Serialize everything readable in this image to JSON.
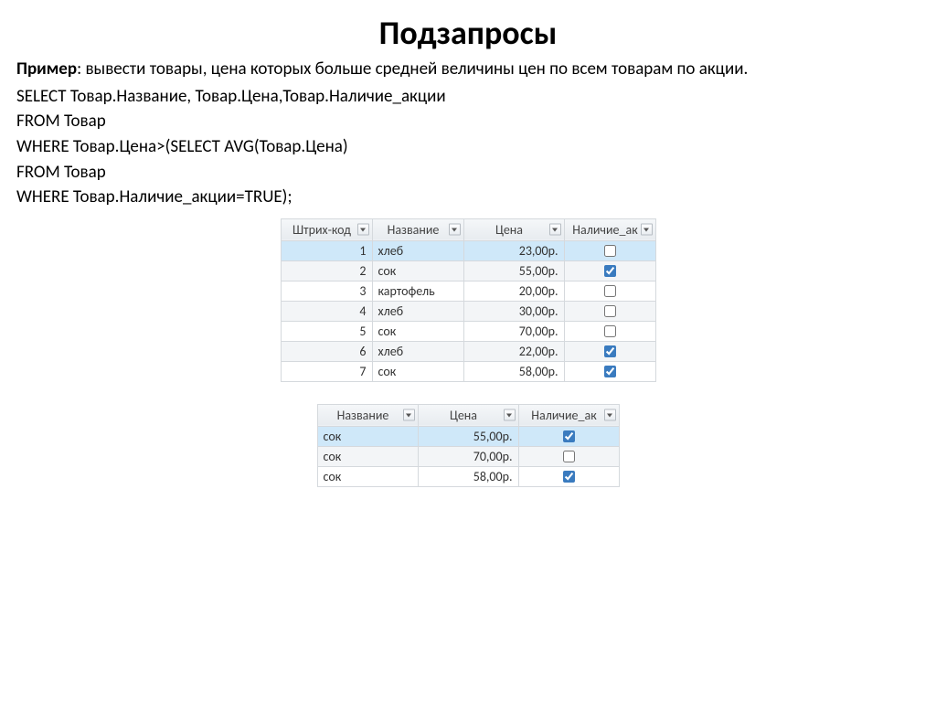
{
  "title": "Подзапросы",
  "desc_bold": "Пример",
  "desc_rest": ": вывести товары, цена которых больше средней величины цен по всем товарам по акции.",
  "sql": [
    "SELECT Товар.Название, Товар.Цена,Товар.Наличие_акции",
    "FROM Товар",
    "WHERE Товар.Цена>(SELECT AVG(Товар.Цена)",
    "FROM Товар",
    "WHERE Товар.Наличие_акции=TRUE);"
  ],
  "table1": {
    "headers": [
      "Штрих-код",
      "Название",
      "Цена",
      "Наличие_ак"
    ],
    "rows": [
      {
        "code": "1",
        "name": "хлеб",
        "price": "23,00р.",
        "sale": false,
        "sel": true
      },
      {
        "code": "2",
        "name": "сок",
        "price": "55,00р.",
        "sale": true,
        "alt": true
      },
      {
        "code": "3",
        "name": "картофель",
        "price": "20,00р.",
        "sale": false
      },
      {
        "code": "4",
        "name": "хлеб",
        "price": "30,00р.",
        "sale": false,
        "alt": true
      },
      {
        "code": "5",
        "name": "сок",
        "price": "70,00р.",
        "sale": false
      },
      {
        "code": "6",
        "name": "хлеб",
        "price": "22,00р.",
        "sale": true,
        "alt": true
      },
      {
        "code": "7",
        "name": "сок",
        "price": "58,00р.",
        "sale": true
      }
    ]
  },
  "table2": {
    "headers": [
      "Название",
      "Цена",
      "Наличие_ак"
    ],
    "rows": [
      {
        "name": "сок",
        "price": "55,00р.",
        "sale": true,
        "sel": true
      },
      {
        "name": "сок",
        "price": "70,00р.",
        "sale": false,
        "alt": true
      },
      {
        "name": "сок",
        "price": "58,00р.",
        "sale": true
      }
    ]
  }
}
